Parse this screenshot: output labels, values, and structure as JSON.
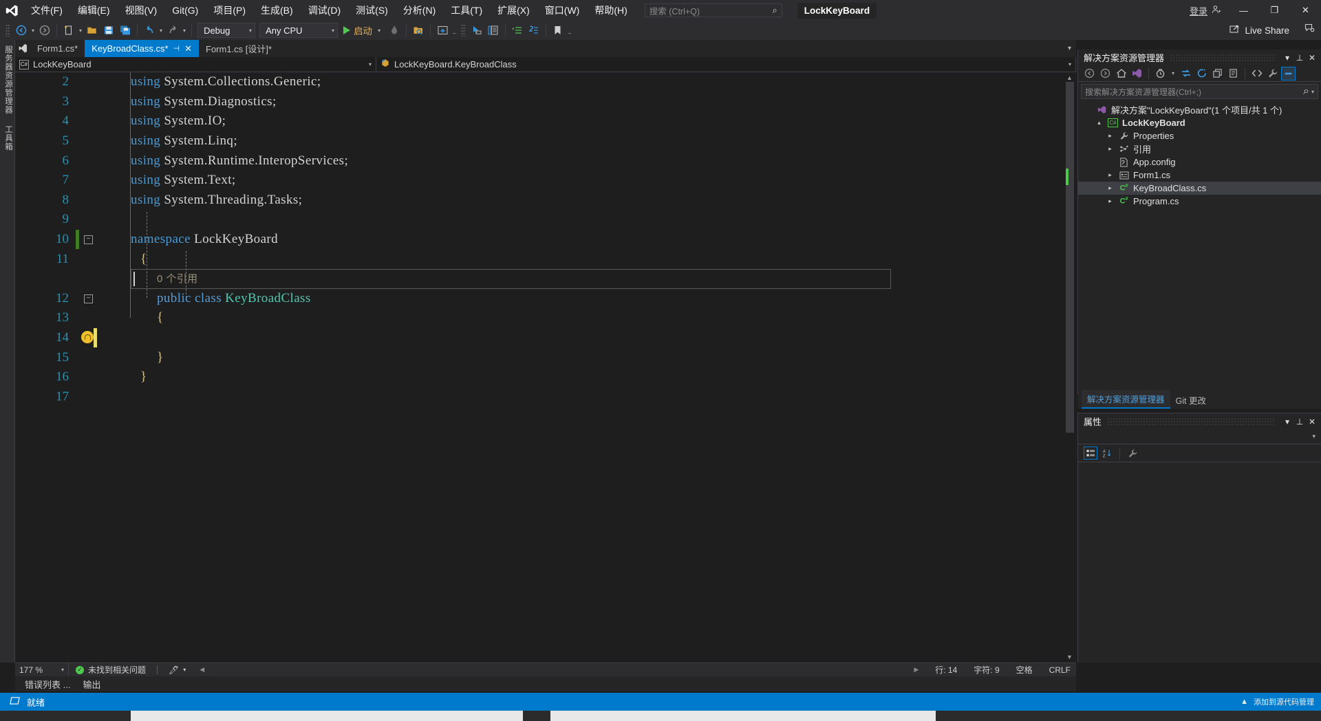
{
  "titlebar": {
    "logo_icon": "visual-studio-logo",
    "menus": [
      {
        "label": "文件(F)"
      },
      {
        "label": "编辑(E)"
      },
      {
        "label": "视图(V)"
      },
      {
        "label": "Git(G)"
      },
      {
        "label": "项目(P)"
      },
      {
        "label": "生成(B)"
      },
      {
        "label": "调试(D)"
      },
      {
        "label": "测试(S)"
      },
      {
        "label": "分析(N)"
      },
      {
        "label": "工具(T)"
      },
      {
        "label": "扩展(X)"
      },
      {
        "label": "窗口(W)"
      },
      {
        "label": "帮助(H)"
      }
    ],
    "search_placeholder": "搜索 (Ctrl+Q)",
    "search_icon": "search-icon",
    "project_title": "LockKeyBoard",
    "signin_label": "登录",
    "signin_icon": "account-add-icon",
    "minimize": "—",
    "maximize": "❐",
    "close": "✕"
  },
  "toolbar": {
    "nav_back": "◉",
    "nav_forward": "◎",
    "new_item": "new-item-icon",
    "open_file": "open-folder-icon",
    "save": "save-icon",
    "save_all": "save-all-icon",
    "undo": "↰",
    "redo": "↱",
    "config": "Debug",
    "platform": "Any CPU",
    "run_label": "启动",
    "hot_reload": "hot-reload-icon",
    "find_in_files": "find-in-files-icon",
    "preview_home": "preview-icon",
    "select_element": "select-element-icon",
    "compare_icon": "compare-icon",
    "indent_icon": "indent-icon",
    "outdent_icon": "outdent-icon",
    "bookmark_icon": "bookmark-icon",
    "live_share_label": "Live Share",
    "live_share_icon": "live-share-icon",
    "feedback_icon": "feedback-icon"
  },
  "leftrail": {
    "tabs": [
      "服务器资源管理器",
      "工具箱"
    ]
  },
  "tabs": {
    "items": [
      {
        "label": "Form1.cs*",
        "active": false,
        "closable": false
      },
      {
        "label": "KeyBroadClass.cs*",
        "active": true,
        "closable": true,
        "pin_icon": "pin-icon",
        "close_icon": "close-icon"
      },
      {
        "label": "Form1.cs [设计]*",
        "active": false,
        "closable": false
      }
    ],
    "overflow_icon": "chevron-down-icon",
    "settings_icon": "gear-icon"
  },
  "navbar": {
    "left_icon": "csharp-project-icon",
    "left_label": "LockKeyBoard",
    "right_icon": "class-member-icon",
    "right_label": "LockKeyBoard.KeyBroadClass",
    "caret_icon": "chevron-down-icon"
  },
  "editor": {
    "lines": [
      {
        "num": "2",
        "indent": 0,
        "tokens": [
          {
            "t": "using",
            "c": "kw"
          },
          {
            "t": " System.Collections.Generic;",
            "c": "pun"
          }
        ]
      },
      {
        "num": "3",
        "indent": 0,
        "tokens": [
          {
            "t": "using",
            "c": "kw"
          },
          {
            "t": " System.Diagnostics;",
            "c": "pun"
          }
        ]
      },
      {
        "num": "4",
        "indent": 0,
        "tokens": [
          {
            "t": "using",
            "c": "kw"
          },
          {
            "t": " System.IO;",
            "c": "pun"
          }
        ]
      },
      {
        "num": "5",
        "indent": 0,
        "tokens": [
          {
            "t": "using",
            "c": "kw"
          },
          {
            "t": " System.Linq;",
            "c": "pun"
          }
        ]
      },
      {
        "num": "6",
        "indent": 0,
        "tokens": [
          {
            "t": "using",
            "c": "kw"
          },
          {
            "t": " System.Runtime.InteropServices;",
            "c": "pun"
          }
        ]
      },
      {
        "num": "7",
        "indent": 0,
        "tokens": [
          {
            "t": "using",
            "c": "kw"
          },
          {
            "t": " System.Text;",
            "c": "pun"
          }
        ]
      },
      {
        "num": "8",
        "indent": 0,
        "tokens": [
          {
            "t": "using",
            "c": "kw"
          },
          {
            "t": " System.Threading.Tasks;",
            "c": "pun"
          }
        ]
      },
      {
        "num": "9",
        "indent": 0,
        "tokens": []
      },
      {
        "num": "10",
        "indent": 0,
        "tokens": [
          {
            "t": "namespace",
            "c": "kw"
          },
          {
            "t": " LockKeyBoard",
            "c": "pun"
          }
        ]
      },
      {
        "num": "11",
        "indent": 1,
        "tokens": [
          {
            "t": "{",
            "c": "brc"
          }
        ]
      },
      {
        "num": "",
        "indent": 2,
        "tokens": [
          {
            "t": "0 个引用",
            "c": "ref"
          }
        ]
      },
      {
        "num": "12",
        "indent": 2,
        "tokens": [
          {
            "t": "public",
            "c": "kw2"
          },
          {
            "t": " ",
            "c": "pun"
          },
          {
            "t": "class",
            "c": "kw2"
          },
          {
            "t": " ",
            "c": "pun"
          },
          {
            "t": "KeyBroadClass",
            "c": "typ"
          }
        ]
      },
      {
        "num": "13",
        "indent": 2,
        "tokens": [
          {
            "t": "{",
            "c": "brc"
          }
        ]
      },
      {
        "num": "14",
        "indent": 3,
        "tokens": []
      },
      {
        "num": "15",
        "indent": 2,
        "tokens": [
          {
            "t": "}",
            "c": "brc"
          }
        ]
      },
      {
        "num": "16",
        "indent": 1,
        "tokens": [
          {
            "t": "}",
            "c": "brc"
          }
        ]
      },
      {
        "num": "17",
        "indent": 0,
        "tokens": []
      }
    ],
    "reference_text": "0 个引用",
    "lightbulb_icon": "lightbulb-icon",
    "fold_icon": "collapse-box-icon"
  },
  "editor_status": {
    "zoom": "177 %",
    "zoom_caret": "chevron-down-icon",
    "issues_icon": "check-circle-icon",
    "issues_label": "未找到相关问题",
    "brush_icon": "pen-icon",
    "prev_icon": "chevron-left-icon",
    "next_icon": "chevron-right-icon",
    "line_label": "行: 14",
    "col_label": "字符: 9",
    "space_label": "空格",
    "eol_label": "CRLF"
  },
  "bottom_tabs": [
    {
      "label": "错误列表 ..."
    },
    {
      "label": "输出"
    }
  ],
  "solution_explorer": {
    "title": "解决方案资源管理器",
    "dropdown_icon": "chevron-down-icon",
    "pin_icon": "pin-icon",
    "close_icon": "close-icon",
    "toolbar_icons": [
      {
        "name": "back-icon",
        "glyph": "⬤",
        "style": "plain"
      },
      {
        "name": "forward-icon",
        "glyph": "⬤",
        "style": "plain"
      },
      {
        "name": "home-icon",
        "glyph": "⌂",
        "style": "plain"
      },
      {
        "name": "solution-icon",
        "glyph": "▧",
        "style": "blue"
      },
      {
        "name": "pending-changes-icon",
        "glyph": "◔",
        "style": "plain"
      },
      {
        "name": "sync-icon",
        "glyph": "⇄",
        "style": "blue"
      },
      {
        "name": "refresh-icon",
        "glyph": "⟳",
        "style": "blue"
      },
      {
        "name": "collapse-all-icon",
        "glyph": "⊟",
        "style": "plain"
      },
      {
        "name": "properties-window-icon",
        "glyph": "❐",
        "style": "plain"
      },
      {
        "name": "show-all-files-icon",
        "glyph": "◇",
        "style": "plain"
      },
      {
        "name": "view-code-icon",
        "glyph": "<>",
        "style": "plain"
      },
      {
        "name": "wrench-icon",
        "glyph": "🔧",
        "style": "plain"
      },
      {
        "name": "preview-selected-icon",
        "glyph": "▬",
        "style": "selected"
      }
    ],
    "search_placeholder": "搜索解决方案资源管理器(Ctrl+;)",
    "search_icon": "search-icon",
    "tree": [
      {
        "label": "解决方案\"LockKeyBoard\"(1 个项目/共 1 个)",
        "level": 0,
        "arrow": "",
        "icon": "solution-icon",
        "bold": false,
        "selected": false
      },
      {
        "label": "LockKeyBoard",
        "level": 1,
        "arrow": "▴",
        "icon": "csharp-project-icon",
        "bold": true,
        "selected": false
      },
      {
        "label": "Properties",
        "level": 2,
        "arrow": "▸",
        "icon": "wrench-icon",
        "bold": false,
        "selected": false
      },
      {
        "label": "引用",
        "level": 2,
        "arrow": "▸",
        "icon": "references-icon",
        "bold": false,
        "selected": false
      },
      {
        "label": "App.config",
        "level": 2,
        "arrow": "",
        "icon": "config-file-icon",
        "bold": false,
        "selected": false
      },
      {
        "label": "Form1.cs",
        "level": 2,
        "arrow": "▸",
        "icon": "form-icon",
        "bold": false,
        "selected": false
      },
      {
        "label": "KeyBroadClass.cs",
        "level": 2,
        "arrow": "▸",
        "icon": "csharp-file-icon",
        "bold": false,
        "selected": true
      },
      {
        "label": "Program.cs",
        "level": 2,
        "arrow": "▸",
        "icon": "csharp-file-icon",
        "bold": false,
        "selected": false
      }
    ],
    "panel_tabs": [
      {
        "label": "解决方案资源管理器",
        "active": true
      },
      {
        "label": "Git 更改",
        "active": false
      }
    ]
  },
  "properties": {
    "title": "属性",
    "dropdown_icon": "chevron-down-icon",
    "pin_icon": "pin-icon",
    "close_icon": "close-icon",
    "selector_caret": "chevron-down-icon",
    "tool_categorized": "categorized-icon",
    "tool_alphabetical": "alphabetical-sort-icon",
    "tool_events": "events-icon"
  },
  "windows_status": {
    "icon": "window-icon",
    "label": "就绪",
    "tray_up_icon": "chevron-up-icon",
    "tray_text": "添加到源代码管理"
  },
  "colors": {
    "accent": "#007acc",
    "chrome": "#2d2d30",
    "editor_bg": "#1e1e1e",
    "panel_bg": "#252526",
    "keyword": "#4a9ad4",
    "type": "#4ec9b0",
    "linenum": "#2b91af"
  }
}
